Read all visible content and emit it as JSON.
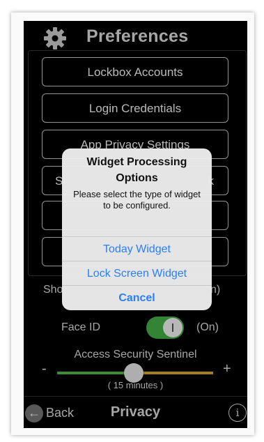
{
  "header": {
    "title": "Preferences",
    "icon": "gear-icon"
  },
  "menu": {
    "items": [
      {
        "label": "Lockbox Accounts"
      },
      {
        "label": "Login Credentials"
      },
      {
        "label": "App Privacy Settings"
      },
      {
        "label": "S"
      },
      {
        "label": "k"
      }
    ]
  },
  "settings": {
    "show_row_left": "Sho",
    "show_row_right": "n)",
    "face_id_label": "Face ID",
    "face_id_state": "(On)",
    "face_id_on": true,
    "sentinel_label": "Access Security Sentinel",
    "minus": "-",
    "plus": "+",
    "minutes_label": "( 15 minutes )"
  },
  "bottom_bar": {
    "back_label": "Back",
    "title": "Privacy",
    "back_icon": "arrow-left-icon",
    "info_icon": "info-icon",
    "info_glyph": "i"
  },
  "alert": {
    "title": "Widget Processing Options",
    "message": "Please select the type of widget to be configured.",
    "buttons": [
      {
        "label": "Today Widget"
      },
      {
        "label": "Lock Screen Widget"
      },
      {
        "label": "Cancel"
      }
    ]
  },
  "colors": {
    "accent_blue": "#2a7ff6",
    "toggle_on": "#48b84a",
    "slider_green": "#58c14f",
    "slider_yellow": "#e2b12c"
  }
}
